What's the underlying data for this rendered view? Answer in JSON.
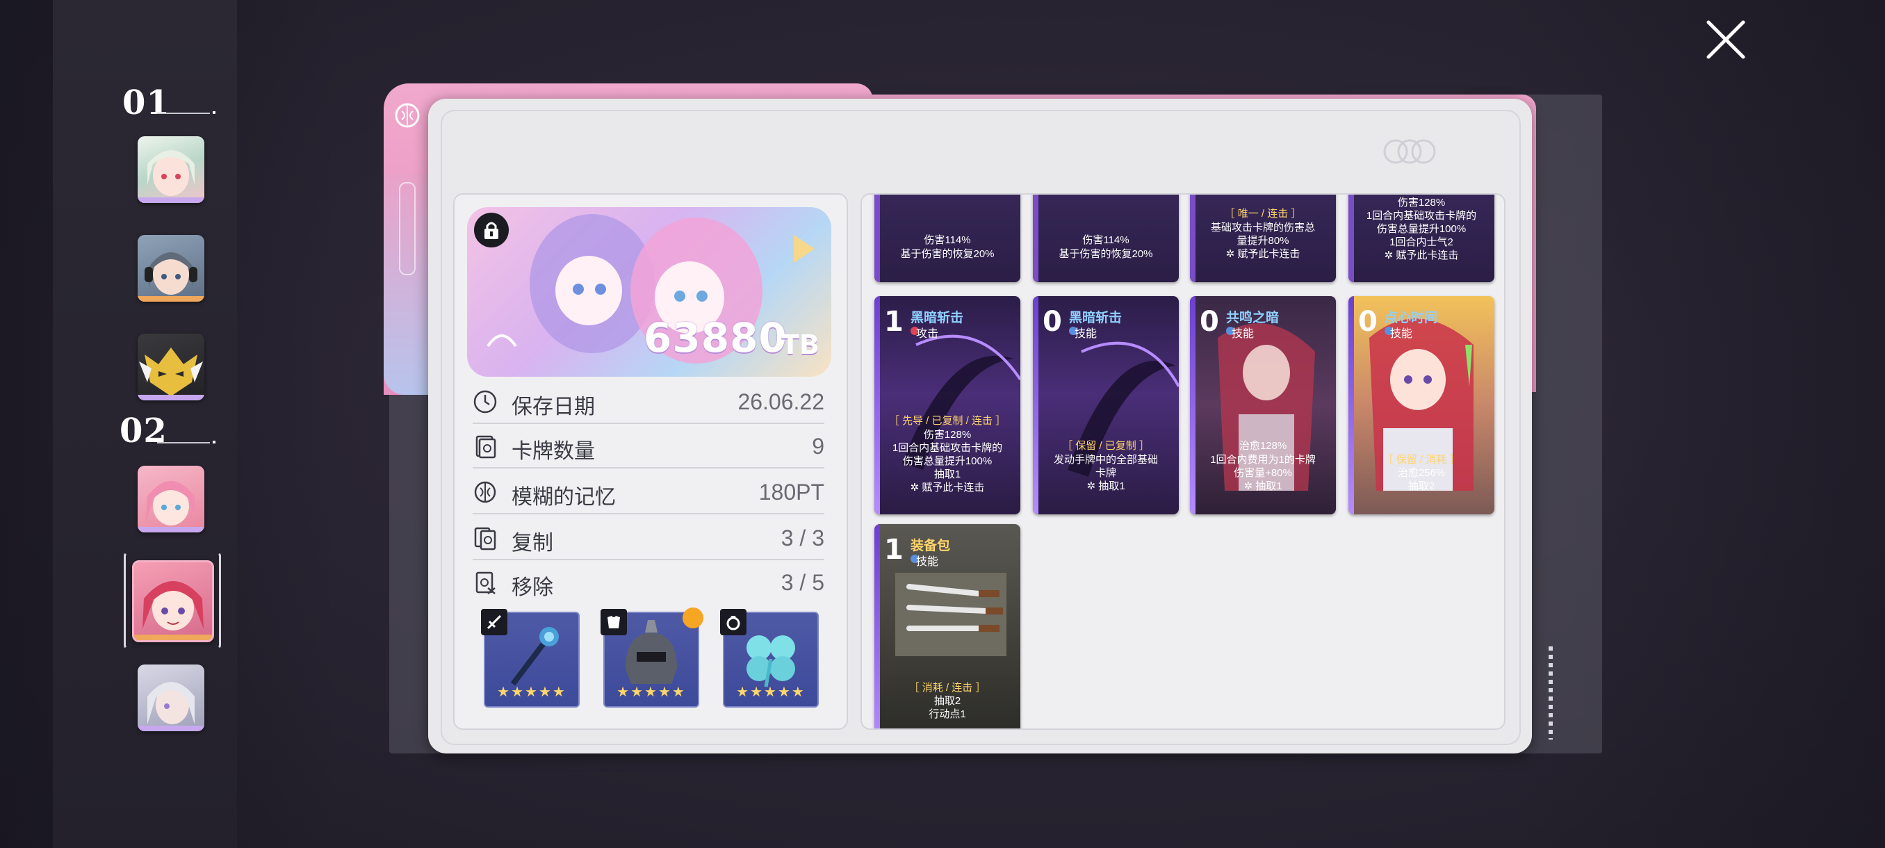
{
  "roster": {
    "groups": [
      {
        "label": "01"
      },
      {
        "label": "02"
      }
    ],
    "portraits": [
      {
        "name": "portrait-white-hair-girl",
        "bar": "#c7a8ef"
      },
      {
        "name": "portrait-headphone-girl",
        "bar": "#f0a85c"
      },
      {
        "name": "portrait-gold-mask",
        "bar": "#c7a8ef"
      },
      {
        "name": "portrait-pink-hair-girl",
        "bar": "#c7a8ef"
      },
      {
        "name": "portrait-red-hair-girl",
        "bar": "#f0a85c"
      },
      {
        "name": "portrait-silver-hair-girl",
        "bar": "#c7a8ef"
      }
    ]
  },
  "deck": {
    "value": "63880",
    "unit": "TB",
    "locked": true
  },
  "info": [
    {
      "label": "保存日期",
      "value": "26.06.22",
      "icon": "clock-icon"
    },
    {
      "label": "卡牌数量",
      "value": "9",
      "icon": "card-icon"
    },
    {
      "label": "模糊的记忆",
      "value": "180PT",
      "icon": "brain-icon"
    },
    {
      "label": "复制",
      "value": "3 / 3",
      "icon": "copy-icon"
    },
    {
      "label": "移除",
      "value": "3 / 5",
      "icon": "remove-card-icon"
    }
  ],
  "equipment": [
    {
      "slot": "weapon",
      "icon": "sword-icon",
      "stars": "★★★★★"
    },
    {
      "slot": "armor",
      "icon": "armor-icon",
      "stars": "★★★★★"
    },
    {
      "slot": "accessory",
      "icon": "ring-icon",
      "stars": "★★★★★"
    }
  ],
  "cards_row0": [
    {
      "lines": [
        "伤害114%",
        "基于伤害的恢复20%"
      ]
    },
    {
      "lines": [
        "伤害114%",
        "基于伤害的恢复20%"
      ]
    },
    {
      "tag": "［ 唯一 / 连击 ］",
      "lines": [
        "基础攻击卡牌的伤害总",
        "量提升80%",
        "✲ 赋予此卡连击"
      ]
    },
    {
      "lines": [
        "伤害128%",
        "1回合内基础攻击卡牌的",
        "伤害总量提升100%",
        "1回合内士气2",
        "✲ 赋予此卡连击"
      ]
    }
  ],
  "cards_row1": [
    {
      "cost": "1",
      "name": "黑暗斩击",
      "type": "攻击",
      "tag": "［ 先导 / 已复制 / 连击 ］",
      "lines": [
        "伤害128%",
        "1回合内基础攻击卡牌的",
        "伤害总量提升100%",
        "抽取1",
        "✲ 赋予此卡连击"
      ]
    },
    {
      "cost": "0",
      "name": "黑暗斩击",
      "type": "技能",
      "tag": "［ 保留 / 已复制 ］",
      "lines": [
        "发动手牌中的全部基础",
        "卡牌",
        "✲ 抽取1"
      ]
    },
    {
      "cost": "0",
      "name": "共鸣之暗",
      "type": "技能",
      "tag": "",
      "lines": [
        "治愈128%",
        "1回合内费用为1的卡牌",
        "伤害量+80%",
        "✲ 抽取1"
      ]
    },
    {
      "cost": "0",
      "name": "点心时间",
      "type": "技能",
      "tag": "［ 保留 / 消耗 ］",
      "lines": [
        "治愈256%",
        "抽取2"
      ]
    }
  ],
  "cards_row2": [
    {
      "cost": "1",
      "name": "装备包",
      "type": "技能",
      "tag": "［ 消耗 / 连击 ］",
      "lines": [
        "抽取2",
        "行动点1"
      ]
    }
  ],
  "colors": {
    "accent_pink": "#ec9bc4",
    "card_dark": "#2d1f45",
    "name_blue": "#8fd0ff",
    "name_gold": "#ffd46a"
  }
}
